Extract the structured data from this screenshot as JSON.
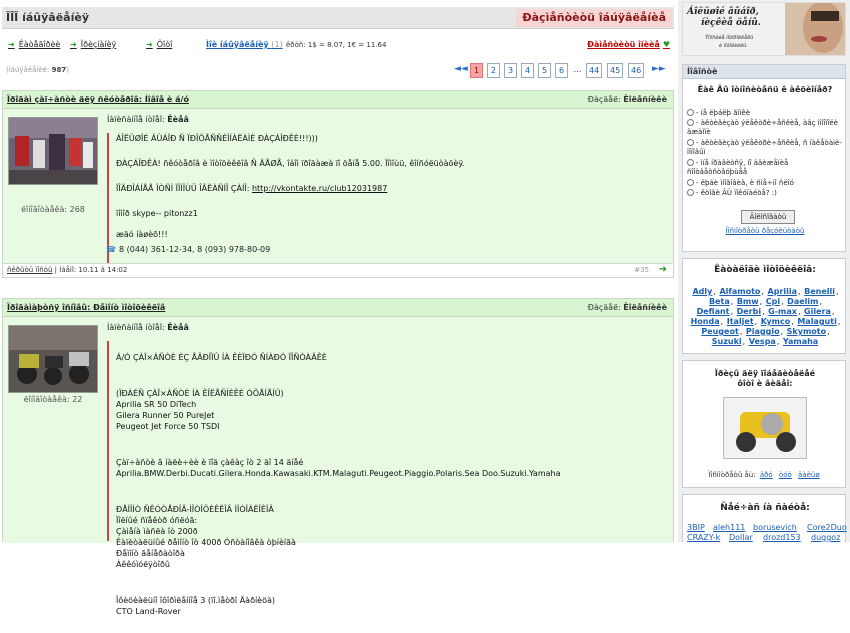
{
  "header": {
    "title": "ÏÎÏ íáûÿâëåíèÿ",
    "ad_label": "Ðàçìåñòèòü îáúÿâëåíèå"
  },
  "toolbar": {
    "items": [
      "Êàòåãîðèè",
      "Ïðèçíàíèÿ",
      "Ôîòî",
      "Ìîè íáûÿâëåíèÿ"
    ],
    "my_count": "(1)",
    "stats": "êðòñ: 1$ = 8.07, 1€ = 11.64",
    "new_post": "Ðàìåñòèòü îíèèå"
  },
  "pager": {
    "label": "(íáúÿâëåíèé: ",
    "total": "987",
    "label_end": ")",
    "prev": "◄◄",
    "pages": [
      "1",
      "2",
      "3",
      "4",
      "5",
      "6",
      "...",
      "44",
      "45",
      "46"
    ],
    "current": "1",
    "next": "►►"
  },
  "posts": [
    {
      "title": "Ïðîäàì çàï÷àñòè äëÿ ñêóòåðîâ: Íîâîå è á/ó",
      "status_label": "Ðàçäåë:",
      "status_value": "Êîëåñíèêè",
      "author_label": "Íàïèñàííîå íòîåî:",
      "author": "Êèåâ",
      "messages": "ëîíîâîòàåêà: 268",
      "paragraphs": [
        "ÁÎËÜØÎÉ ÂÛÁÎÐ Ñ ÏÐÎÔÅÑÑÈÎÍÀËÀÌÈ ÐÀÇÁÎÐÊÈ!!!)))",
        "ÐÀÇÁÎÐÊÀ! ñêóòåðîâ è ìîòîöèêëîâ Ñ ÄÅØÅ, îáîì ïðîäàæà ïî öåíå 5.00. Ïîìîùü, êîíñóëüòàöèÿ.",
        "ÏÎÄÐÎÁÍÅÅ ÎÒÑÌ ÏÎÌÎÙÜ ÎÃËÀÑÍÎ ÇÀÍÎ:",
        "ïîìîð skype--  pitonzz1",
        "æäó íàøèõ!!!"
      ],
      "link": "http://vkontakte.ru/club12031987",
      "phone": "8 (044) 361-12-34, 8 (093) 978-80-09",
      "foot_left": "ñêðûòü ïîñòû",
      "foot_date": "Ìàåìî: 10.11 â 14:02",
      "foot_id": "#35"
    },
    {
      "title": "Ïðîäàìàþòñÿ îñíîâû: Ðåìîíò ìîòîöèêëîâ",
      "status_label": "Ðàçäåë:",
      "status_value": "Êîëåñíèêè",
      "author_label": "Íàïèñàííîå íòîåî:",
      "author": "Êèåâ",
      "messages": "ëîíîâîòàåêà: 22",
      "paragraphs": [
        "Á/Ó ÇÀÏ×ÀÑÒÈ ÈÇ ÅÂÐÎÏÛ ÍÀ ÊÈÏÐÓ ÑÍÀÐÓ ÏÎÑÒÀÂÊÈ",
        "(ÏÐÀÉÑ ÇÀÏ×ÀÑÒÈ ÍÀ ÊÎËÅÑÍÈÊÈ ÓÖÅÍÅÍÛ)\nAprilia SR 50 DiTech\nGilera Runner 50 PureJet\nPeugeot Jet Force 50 TSDI",
        "Çàï÷àñòè â íàëè÷èè è ïîä çàêàç îò 2 äî 14 äíåé\nAprilia.BMW.Derbi.Ducati.Gilera.Honda.Kawasaki.KTM.Malaguti.Peugeot.Piaggio.Polaris.Sea Doo.Suzuki.Yamaha",
        "ÐÅÌÎÍÒ ÑÊÓÒÅÐÎÂ-ÌÎÒÎÖÈÊËÎÂ ÌÎÒÎÁËÎÊÎÂ\nÏîëíûé ñïåêòð óñëóã:\nÇàìåíà ìàñëà îò 200ð\nÊàïèòàëüíûé ðåìîíò  îò 400ð Óñòàíîâêà òþíèíãà\nÐåìîíò ãåíåðàòîðà\nÀêêóìóëÿòîðû",
        "Îôèöèàëüíî îôîðìëåííîå 3 (ïî.ìåòðî Äàðíèöà)\nCTO Land-Rover"
      ],
      "messages_label": ""
    }
  ],
  "sidebar": {
    "banner_line1": "Áîëüøîé âûáîð,",
    "banner_line2": "íèçêèå öåíû.",
    "banner_line3": "Ÿïîíñêèå ìîòîðîëëåðû",
    "banner_line4": "è ìîòîöèêëû.",
    "poll_header": "Íîâîñòè",
    "poll_question": "Êàê Âû îòíîñèòåñü ê àêöèîíåð?",
    "poll_options": [
      "- íå ëþáëþ ãîíêè",
      "- àêòèâèçàò ýëåêòðè÷åñêèå, àâç ìîíîïîëè äæàìïè",
      "- àêòèâèçàò ýëåêòðè÷åñêèå, ñ ïàêåòàìè-ïîïîâûì",
      "- ìíå íðàâèòñÿ, íî äâèæåíèå ñîîòâåòñòâóþùåå",
      "- ëþáè ìíîãîâèä, è ñìå÷íî ñëîó",
      "- êòîâè ÂÛ ïîêóïàéòå? :)"
    ],
    "vote_button": "Ãîëîñîâàòü",
    "results_link": "Ïîñìîòðåòü ðåçóëüòàòû",
    "brands_title": "Êàòàëîãè ìîòîöèêëîâ:",
    "brands": [
      "Adly",
      "Alfamoto",
      "Aprilia",
      "Benelli",
      "Beta",
      "Bmw",
      "Cpi",
      "Daelim",
      "Defiant",
      "Derbi",
      "G-max",
      "Gilera",
      "Honda",
      "Italjet",
      "Kymco",
      "Malaguti",
      "Peugeot",
      "Piaggio",
      "Skymoto",
      "Suzuki",
      "Vespa",
      "Yamaha"
    ],
    "prize_title_1": "Ïðèçû äëÿ ïîáåäèòåëåé",
    "prize_title_2": "ôîòî è âèäåî:",
    "prize_links_label": "Ïîñìîòðåòü åù:",
    "prize_links": [
      "äðó",
      "òóò",
      "äàëüø"
    ],
    "users_title": "Ñåé÷àñ íà ñàéòå:",
    "users": [
      "3BIP",
      "aleh111",
      "borusevich",
      "Core2Duo",
      "CRAZY-k",
      "Dollar",
      "drozd153",
      "duggoz"
    ]
  },
  "colors": {
    "accent_green": "#d9f5d2",
    "post_body": "#e8fae2",
    "link_blue": "#1a5fb4",
    "alert_red": "#c00000"
  }
}
